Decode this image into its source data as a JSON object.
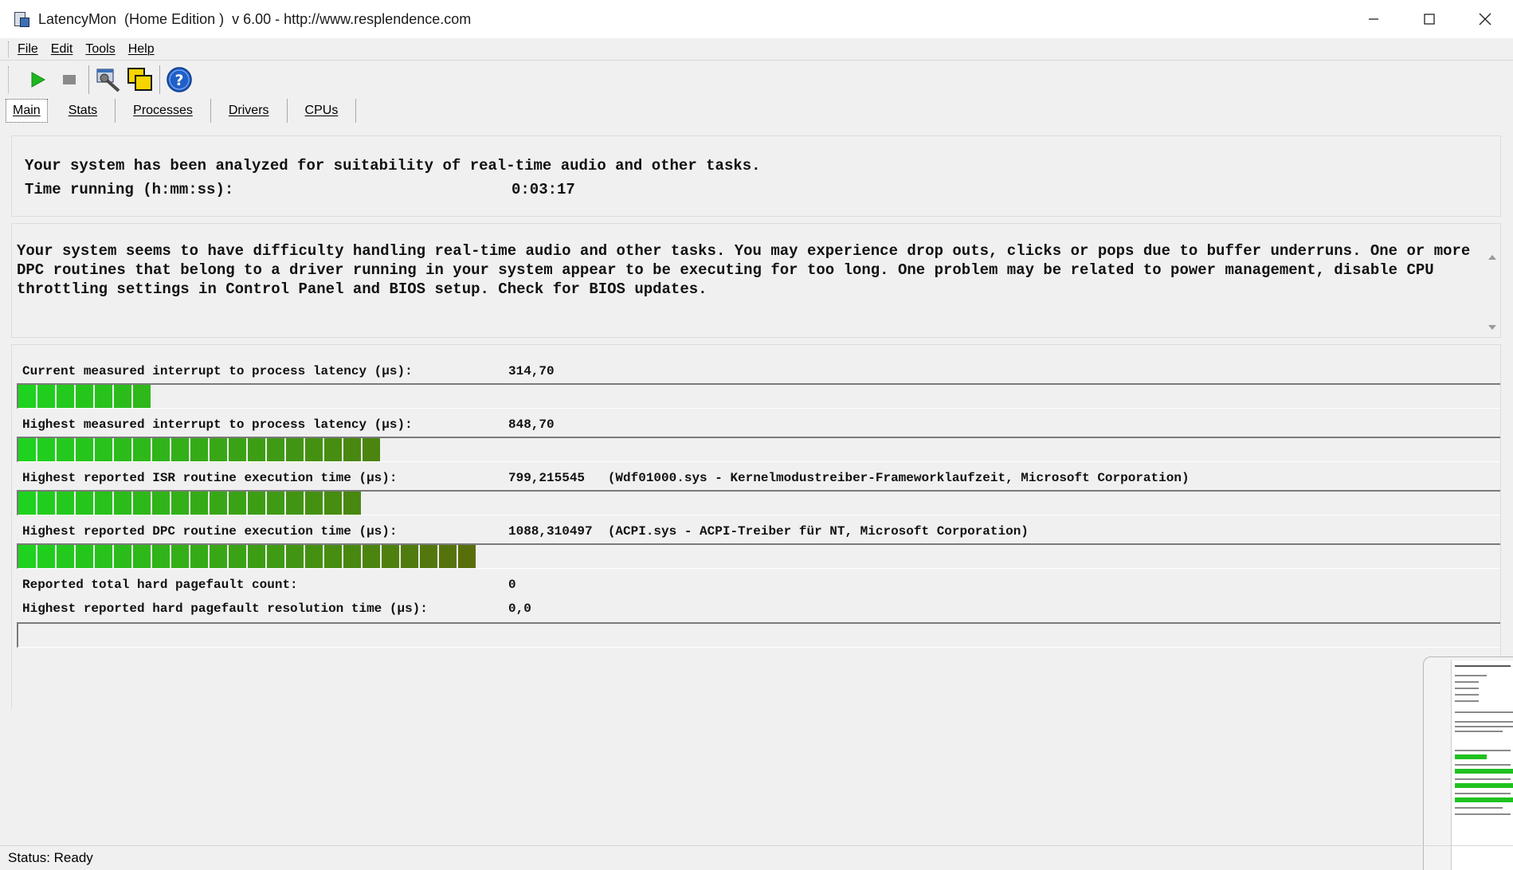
{
  "window": {
    "title": "LatencyMon  (Home Edition )  v 6.00 - http://www.resplendence.com",
    "controls": [
      "minimize-icon",
      "maximize-icon",
      "close-icon"
    ]
  },
  "menu": [
    "File",
    "Edit",
    "Tools",
    "Help"
  ],
  "toolbar": {
    "buttons": [
      "play-icon",
      "stop-icon",
      "wrench-icon",
      "copy-windows-icon",
      "help-icon"
    ],
    "play_color": "#1fb51f",
    "help_color": "#1f5fc8"
  },
  "tabs": [
    "Main",
    "Stats",
    "Processes",
    "Drivers",
    "CPUs"
  ],
  "summary": {
    "line1": "Your system has been analyzed for suitability of real-time audio and other tasks.",
    "time_label": "Time running (h:mm:ss):",
    "time_value": "0:03:17"
  },
  "conclusion": "Your system seems to have difficulty handling real-time audio and other tasks. You may experience drop outs, clicks or pops due to buffer underruns. One or more DPC routines that belong to a driver running in your system appear to be executing for too long. One problem may be related to power management, disable CPU throttling settings in Control Panel and BIOS setup. Check for BIOS updates.",
  "metrics": [
    {
      "label": "Current measured interrupt to process latency (µs):",
      "value": "314,70",
      "segments": 7
    },
    {
      "label": "Highest measured interrupt to process latency (µs):",
      "value": "848,70",
      "segments": 19
    },
    {
      "label": "Highest reported ISR routine execution time (µs):",
      "value": "799,215545   (Wdf01000.sys - Kernelmodustreiber-Frameworklaufzeit, Microsoft Corporation)",
      "segments": 18
    },
    {
      "label": "Highest reported DPC routine execution time (µs):",
      "value": "1088,310497  (ACPI.sys - ACPI-Treiber für NT, Microsoft Corporation)",
      "segments": 24
    }
  ],
  "pagefault": {
    "count_label": "Reported total hard pagefault count:",
    "count_value": "0",
    "time_label": "Highest reported hard pagefault resolution time (µs):",
    "time_value": "0,0",
    "segments": 0
  },
  "status": "Status: Ready",
  "colors": {
    "bar_bright": "#1fd21f",
    "bar_dark": "#5a6a0a"
  }
}
